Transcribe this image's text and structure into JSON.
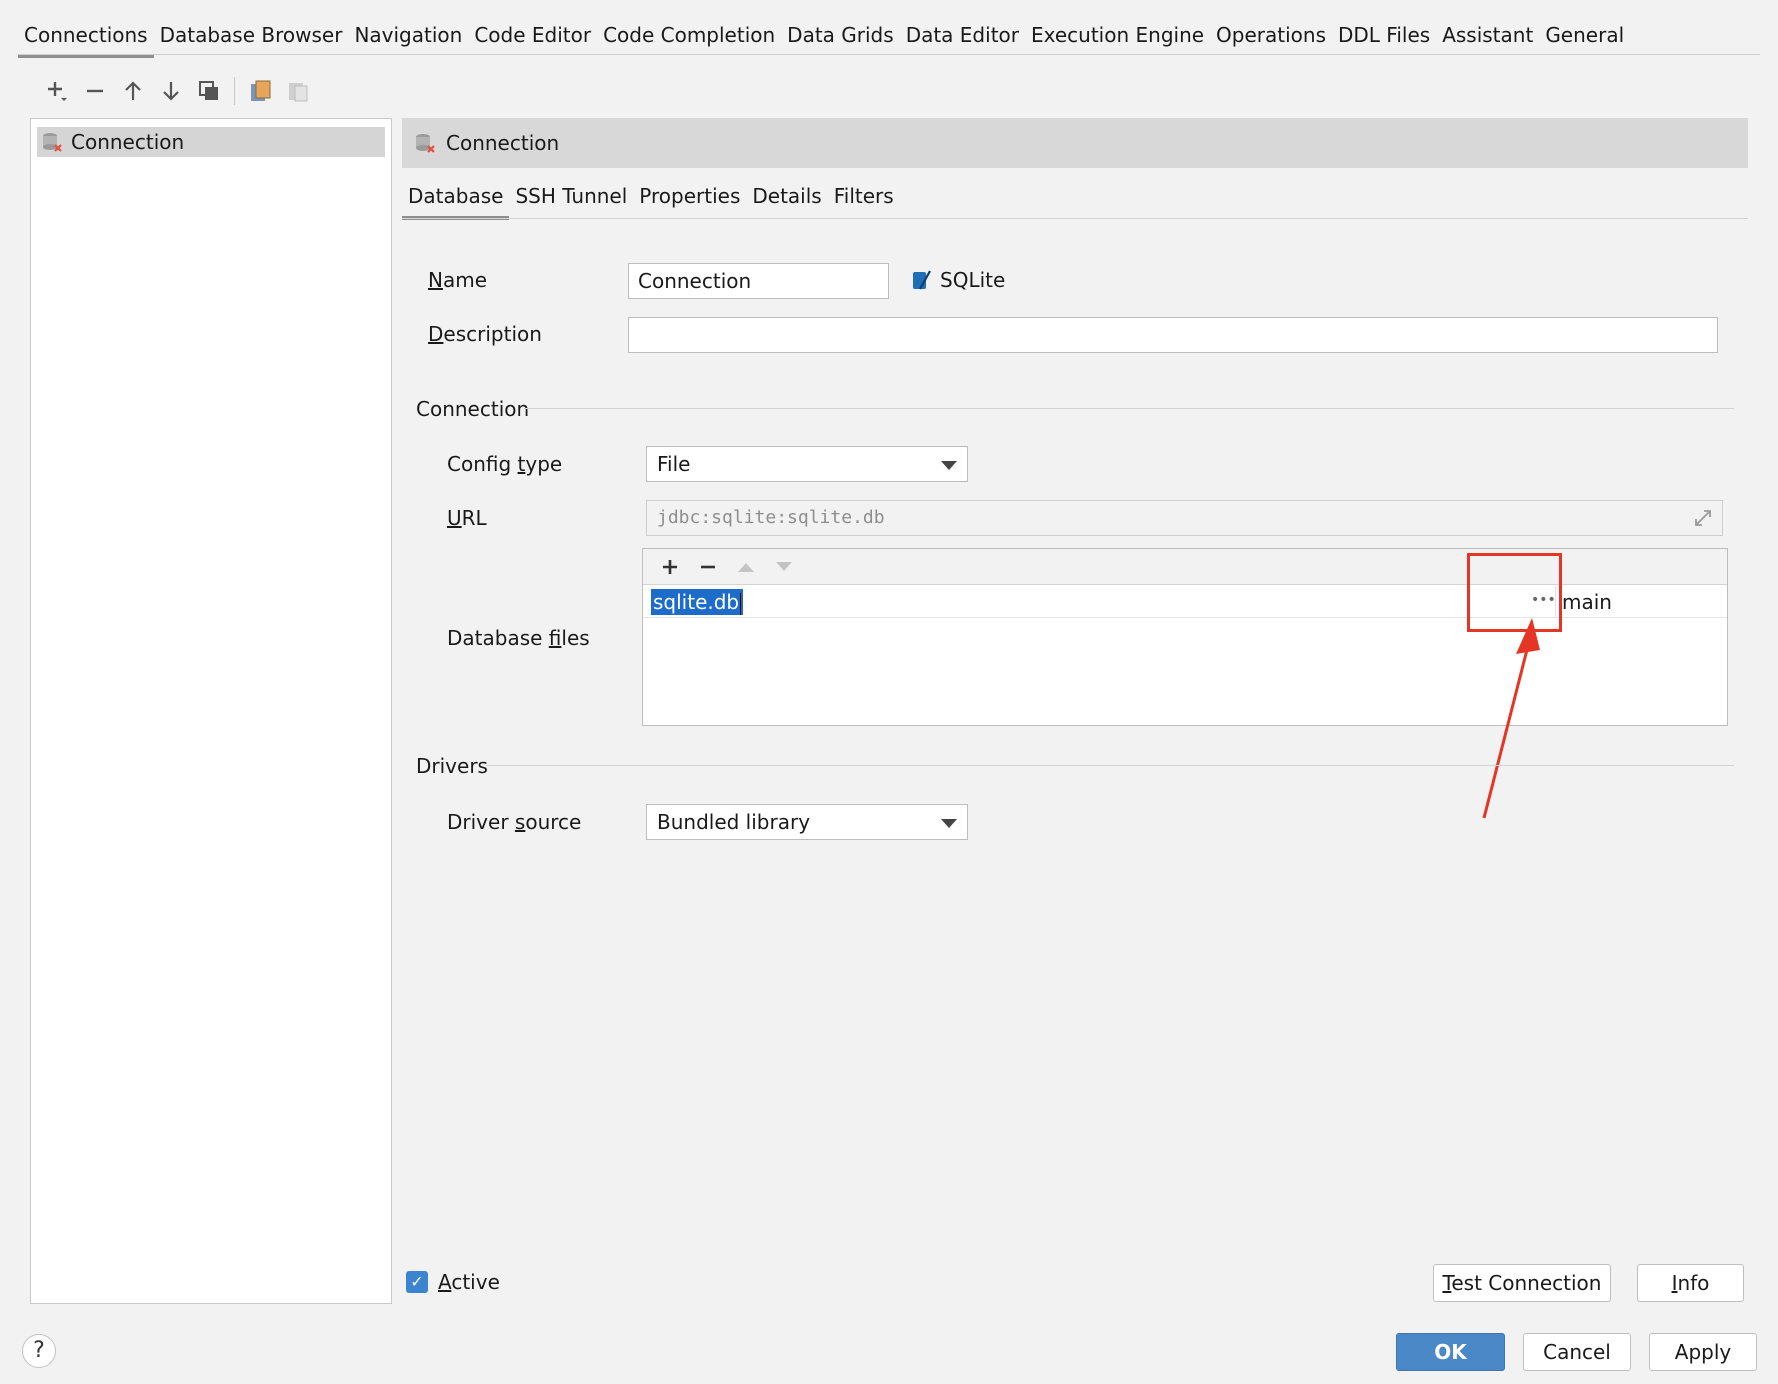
{
  "top_tabs": [
    "Connections",
    "Database Browser",
    "Navigation",
    "Code Editor",
    "Code Completion",
    "Data Grids",
    "Data Editor",
    "Execution Engine",
    "Operations",
    "DDL Files",
    "Assistant",
    "General"
  ],
  "toolbar": {
    "icons": [
      "add-icon",
      "remove-icon",
      "move-up-icon",
      "move-down-icon",
      "copy-icon",
      "export-icon",
      "paste-icon"
    ]
  },
  "left": {
    "items": [
      {
        "label": "Connection",
        "icon": "database-icon"
      }
    ]
  },
  "header": {
    "title": "Connection"
  },
  "sub_tabs": [
    "Database",
    "SSH Tunnel",
    "Properties",
    "Details",
    "Filters"
  ],
  "form": {
    "name_label_first": "N",
    "name_label_rest": "ame",
    "name_value": "Connection",
    "db_type": "SQLite",
    "description_label_first": "D",
    "description_label_rest": "escription",
    "description_value": "",
    "connection_section": "Connection",
    "config_type_label_pre": "Config ",
    "config_type_label_u": "t",
    "config_type_label_post": "ype",
    "config_type_value": "File",
    "url_label_first": "U",
    "url_label_rest": "RL",
    "url_value": "jdbc:sqlite:sqlite.db",
    "db_files_label_pre": "Database ",
    "db_files_label_u": "f",
    "db_files_label_post": "iles",
    "db_files": [
      {
        "path": "sqlite.db",
        "alias": "main"
      }
    ],
    "drivers_section": "Drivers",
    "driver_source_label_pre": "Driver ",
    "driver_source_label_u": "s",
    "driver_source_label_post": "ource",
    "driver_source_value": "Bundled library"
  },
  "footer": {
    "active_label_first": "A",
    "active_label_rest": "ctive",
    "active_checked": true,
    "test_connection_first": "T",
    "test_connection_rest": "est Connection",
    "info_first": "I",
    "info_rest": "nfo",
    "ok": "OK",
    "cancel": "Cancel",
    "apply": "Apply",
    "help": "?"
  },
  "colors": {
    "accent": "#4a88c7",
    "selection": "#1e6cc9",
    "annotation": "#e53525"
  }
}
